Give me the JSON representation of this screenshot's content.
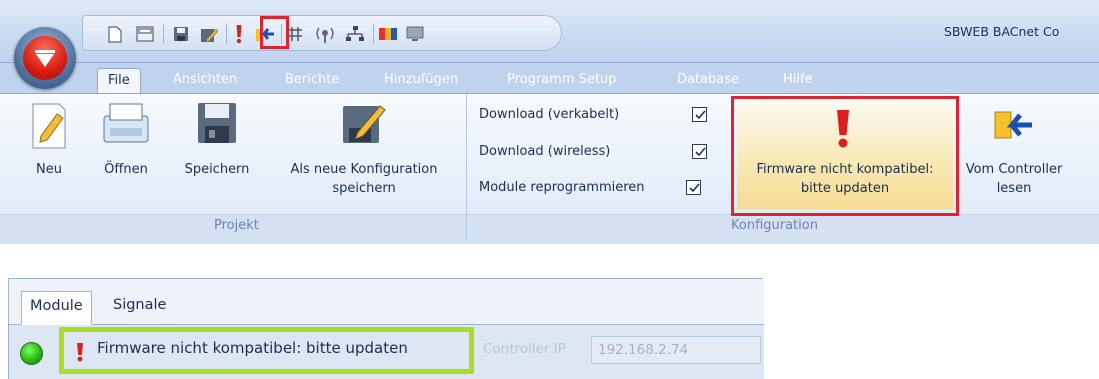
{
  "window": {
    "title": "SBWEB BACnet Co",
    "app_logo": "carlo-gavazzi-logo"
  },
  "quick_access": {
    "icons": [
      "new-file-icon",
      "open-icon",
      "save-icon",
      "save-as-icon",
      "firmware-warning-icon",
      "read-from-controller-icon",
      "network-icon",
      "wireless-icon",
      "topology-icon",
      "colors-icon",
      "monitor-icon"
    ]
  },
  "tabs": [
    {
      "label": "File",
      "active": true
    },
    {
      "label": "Ansichten"
    },
    {
      "label": "Berichte"
    },
    {
      "label": "Hinzufügen"
    },
    {
      "label": "Programm Setup"
    },
    {
      "label": "Database"
    },
    {
      "label": "Hilfe"
    }
  ],
  "ribbon": {
    "projekt": {
      "label": "Projekt",
      "buttons": [
        {
          "label": "Neu",
          "icon": "new-icon"
        },
        {
          "label": "Öffnen",
          "icon": "open-icon"
        },
        {
          "label": "Speichern",
          "icon": "save-icon"
        },
        {
          "label_line1": "Als neue Konfiguration",
          "label_line2": "speichern",
          "icon": "save-as-icon"
        }
      ]
    },
    "konfiguration": {
      "label": "Konfiguration",
      "checks": [
        {
          "label": "Download (verkabelt)",
          "checked": true
        },
        {
          "label": "Download (wireless)",
          "checked": true
        },
        {
          "label": "Module reprogrammieren",
          "checked": true
        }
      ],
      "firmware": {
        "line1": "Firmware nicht kompatibel:",
        "line2": "bitte updaten",
        "icon": "warning-icon"
      },
      "read": {
        "line1": "Vom Controller",
        "line2": "lesen",
        "icon": "read-from-controller-icon"
      }
    }
  },
  "panel": {
    "tabs": [
      "Module",
      "Signale"
    ],
    "status": {
      "led_color": "#22b313",
      "text": "Firmware nicht kompatibel: bitte updaten"
    },
    "ip": {
      "label": "Controller IP",
      "value": "192.168.2.74"
    }
  },
  "colors": {
    "highlight_red": "#e0242f",
    "highlight_green": "#a8df20"
  }
}
